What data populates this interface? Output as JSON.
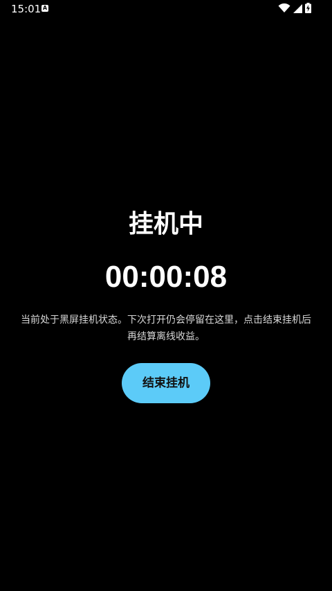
{
  "status_bar": {
    "time": "15:01",
    "notification_icon": "a-icon",
    "icons": [
      "wifi-icon",
      "signal-icon",
      "battery-charging-icon"
    ]
  },
  "main": {
    "title": "挂机中",
    "timer": "00:00:08",
    "description": "当前处于黑屏挂机状态。下次打开仍会停留在这里，点击结束挂机后再结算离线收益。",
    "end_button_label": "结束挂机"
  },
  "colors": {
    "background": "#000000",
    "text": "#ffffff",
    "button": "#5ccbf8"
  }
}
